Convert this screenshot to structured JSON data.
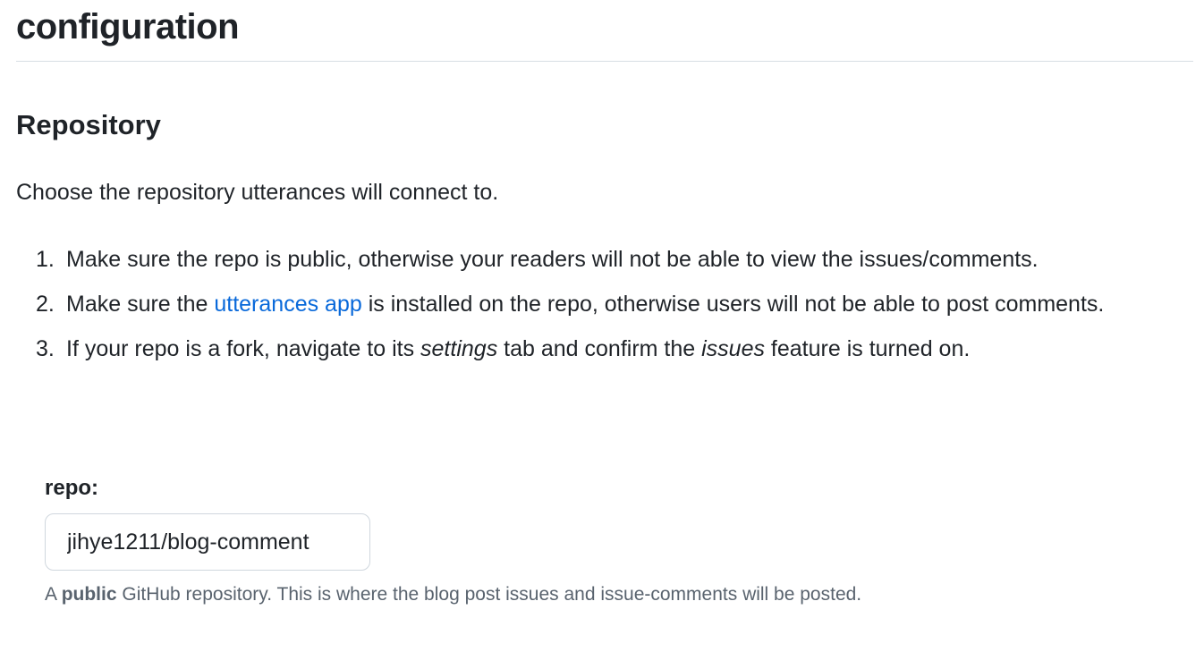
{
  "heading": "configuration",
  "section": {
    "title": "Repository",
    "intro": "Choose the repository utterances will connect to."
  },
  "steps": [
    {
      "num": "1.",
      "text": "Make sure the repo is public, otherwise your readers will not be able to view the issues/comments."
    },
    {
      "num": "2.",
      "pre": "Make sure the ",
      "link": "utterances app",
      "post": " is installed on the repo, otherwise users will not be able to post comments."
    },
    {
      "num": "3.",
      "pre": "If your repo is a fork, navigate to its ",
      "em1": "settings",
      "mid": " tab and confirm the ",
      "em2": "issues",
      "post": " feature is turned on."
    }
  ],
  "repo_field": {
    "label": "repo:",
    "value": "jihye1211/blog-comment"
  },
  "note": {
    "prefix": "A ",
    "strong": "public",
    "rest": " GitHub repository. This is where the blog post issues and issue-comments will be posted."
  }
}
